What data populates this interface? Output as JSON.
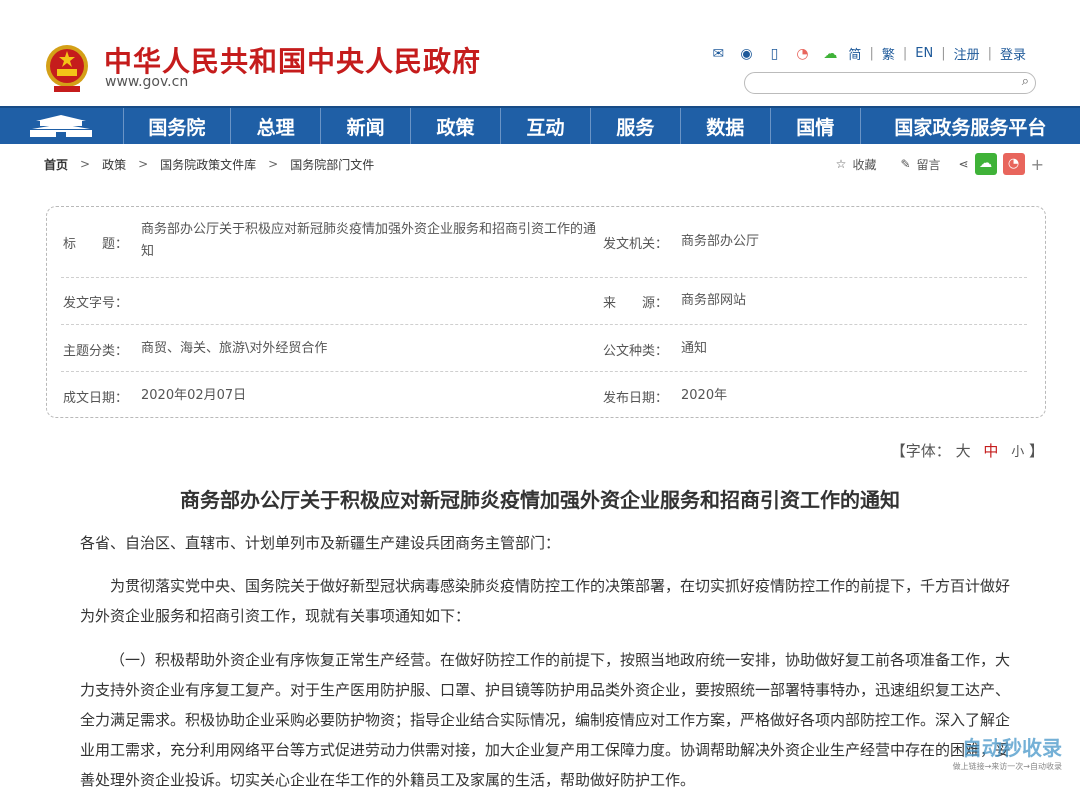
{
  "header": {
    "site_title": "中华人民共和国中央人民政府",
    "site_url": "www.gov.cn",
    "lang_links": [
      "简",
      "繁",
      "EN",
      "注册",
      "登录"
    ],
    "icons": [
      "mail-icon",
      "chat-icon",
      "mobile-icon",
      "weibo-icon",
      "wechat-icon"
    ]
  },
  "nav": {
    "items": [
      "国务院",
      "总理",
      "新闻",
      "政策",
      "互动",
      "服务",
      "数据",
      "国情",
      "国家政务服务平台"
    ]
  },
  "breadcrumb": {
    "items": [
      "首页",
      "政策",
      "国务院政策文件库",
      "国务院部门文件"
    ],
    "actions": {
      "favorite": "收藏",
      "comment": "留言"
    }
  },
  "info": {
    "title_label": "标　　题：",
    "title_value": "商务部办公厅关于积极应对新冠肺炎疫情加强外资企业服务和招商引资工作的通知",
    "issuer_label": "发文机关：",
    "issuer_value": "商务部办公厅",
    "doc_no_label": "发文字号：",
    "doc_no_value": "",
    "source_label": "来　　源：",
    "source_value": "商务部网站",
    "topic_label": "主题分类：",
    "topic_value": "商贸、海关、旅游\\对外经贸合作",
    "type_label": "公文种类：",
    "type_value": "通知",
    "written_label": "成文日期：",
    "written_value": "2020年02月07日",
    "published_label": "发布日期：",
    "published_value": "2020年"
  },
  "font_size": {
    "prefix": "【字体：",
    "large": "大",
    "medium": "中",
    "small": "小",
    "suffix": "】"
  },
  "doc": {
    "title": "商务部办公厅关于积极应对新冠肺炎疫情加强外资企业服务和招商引资工作的通知",
    "recipients": "各省、自治区、直辖市、计划单列市及新疆生产建设兵团商务主管部门：",
    "para1": "为贯彻落实党中央、国务院关于做好新型冠状病毒感染肺炎疫情防控工作的决策部署，在切实抓好疫情防控工作的前提下，千方百计做好为外资企业服务和招商引资工作，现就有关事项通知如下：",
    "para2": "（一）积极帮助外资企业有序恢复正常生产经营。在做好防控工作的前提下，按照当地政府统一安排，协助做好复工前各项准备工作，大力支持外资企业有序复工复产。对于生产医用防护服、口罩、护目镜等防护用品类外资企业，要按照统一部署特事特办，迅速组织复工达产、全力满足需求。积极协助企业采购必要防护物资；指导企业结合实际情况，编制疫情应对工作方案，严格做好各项内部防控工作。深入了解企业用工需求，充分利用网络平台等方式促进劳动力供需对接，加大企业复产用工保障力度。协调帮助解决外资企业生产经营中存在的困难，妥善处理外资企业投诉。切实关心企业在华工作的外籍员工及家属的生活，帮助做好防护工作。"
  },
  "watermark": {
    "main": "自动秒收录",
    "sub": "做上链接→来访一次→自动收录"
  },
  "colors": {
    "brand_red": "#c51c1c",
    "nav_blue": "#1f5fa6",
    "wechat_green": "#3fb238",
    "weibo_red": "#e8655c"
  }
}
